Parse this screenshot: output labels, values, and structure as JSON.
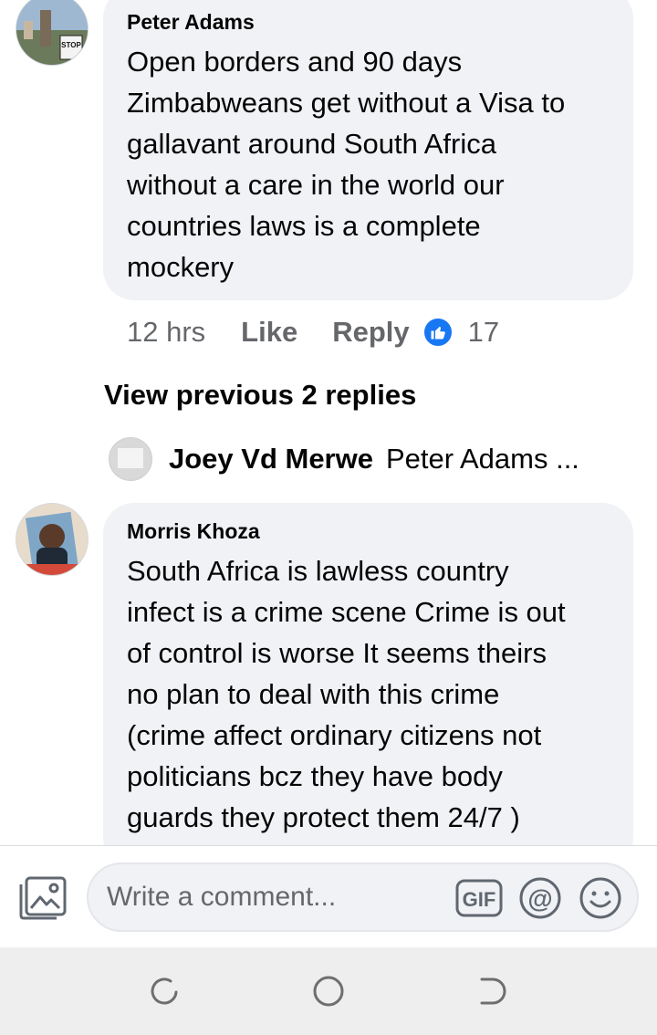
{
  "comments": [
    {
      "author": "Peter Adams",
      "lines": [
        "Open borders and 90 days",
        "Zimbabweans get without a Visa to",
        "gallavant around South Africa",
        "without a care in the world our",
        "countries laws is a complete",
        "mockery"
      ],
      "time": "12 hrs",
      "like_label": "Like",
      "reply_label": "Reply",
      "reaction_count": "17",
      "avatar_sign_text": "STOP"
    },
    {
      "author": "Morris Khoza",
      "lines": [
        "South Africa is lawless country",
        "infect is a crime scene Crime is out",
        "of control is worse It seems theirs",
        "no plan to deal with this crime",
        "(crime affect ordinary citizens not",
        "politicians bcz they have body",
        "guards they protect them 24/7 )"
      ]
    }
  ],
  "view_previous_label": "View previous 2 replies",
  "reply_preview": {
    "author": "Joey Vd Merwe",
    "snippet": "Peter Adams ..."
  },
  "composer": {
    "placeholder": "Write a comment...",
    "gif_label": "GIF",
    "icons": [
      "photo-icon",
      "gif-icon",
      "mention-icon",
      "emoji-icon"
    ]
  },
  "navigation": {
    "icons": [
      "recent-apps-icon",
      "home-icon",
      "back-icon"
    ]
  },
  "colors": {
    "bubble": "#f0f2f5",
    "secondary_text": "#65676b",
    "like_blue": "#1877f2"
  }
}
